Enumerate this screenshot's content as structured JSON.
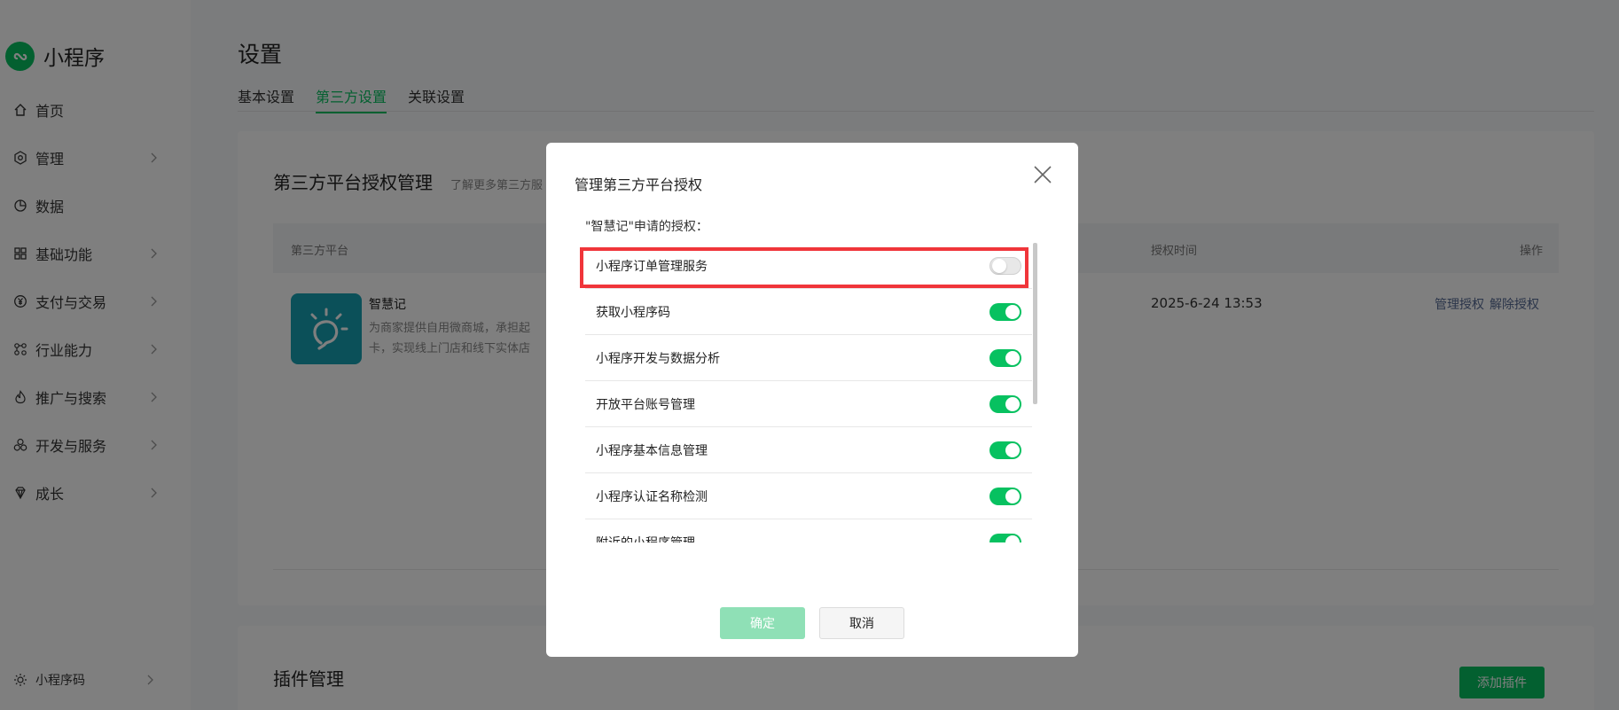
{
  "brand": {
    "title": "小程序"
  },
  "sidebar": {
    "items": [
      {
        "label": "首页",
        "icon": "home-icon",
        "has_chevron": false
      },
      {
        "label": "管理",
        "icon": "hexagon-gear-icon",
        "has_chevron": true
      },
      {
        "label": "数据",
        "icon": "pie-chart-icon",
        "has_chevron": false
      },
      {
        "label": "基础功能",
        "icon": "grid-icon",
        "has_chevron": true
      },
      {
        "label": "支付与交易",
        "icon": "yen-icon",
        "has_chevron": true
      },
      {
        "label": "行业能力",
        "icon": "nodes-icon",
        "has_chevron": true
      },
      {
        "label": "推广与搜索",
        "icon": "flame-icon",
        "has_chevron": true
      },
      {
        "label": "开发与服务",
        "icon": "circles-icon",
        "has_chevron": true
      },
      {
        "label": "成长",
        "icon": "gem-icon",
        "has_chevron": true
      }
    ],
    "bottom": {
      "label": "小程序码",
      "icon": "sun-icon"
    }
  },
  "page": {
    "title": "设置",
    "tabs": [
      {
        "label": "基本设置",
        "active": false
      },
      {
        "label": "第三方设置",
        "active": true
      },
      {
        "label": "关联设置",
        "active": false
      }
    ]
  },
  "third_party": {
    "title": "第三方平台授权管理",
    "subtitle": "了解更多第三方服",
    "columns": {
      "platform": "第三方平台",
      "auth_time": "授权时间",
      "action": "操作"
    },
    "row": {
      "name": "智慧记",
      "desc_line1": "为商家提供自用微商城，承担起",
      "desc_line2": "卡，实现线上门店和线下实体店",
      "auth_time": "2025-6-24 13:53",
      "action_manage": "管理授权",
      "action_revoke": "解除授权"
    }
  },
  "plugins": {
    "title": "插件管理",
    "add_label": "添加插件"
  },
  "modal": {
    "title": "管理第三方平台授权",
    "subtitle": "\"智慧记\"申请的授权：",
    "permissions": [
      {
        "label": "小程序订单管理服务",
        "enabled": false
      },
      {
        "label": "获取小程序码",
        "enabled": true
      },
      {
        "label": "小程序开发与数据分析",
        "enabled": true
      },
      {
        "label": "开放平台账号管理",
        "enabled": true
      },
      {
        "label": "小程序基本信息管理",
        "enabled": true
      },
      {
        "label": "小程序认证名称检测",
        "enabled": true
      },
      {
        "label": "附近的小程序管理",
        "enabled": true
      }
    ],
    "confirm_label": "确定",
    "cancel_label": "取消"
  },
  "colors": {
    "accent": "#07c160",
    "highlight": "#f0353a",
    "link": "#576b95"
  }
}
